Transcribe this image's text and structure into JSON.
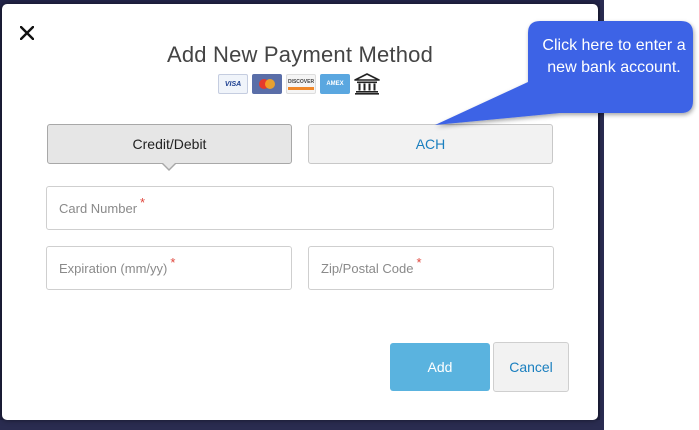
{
  "modal": {
    "title": "Add New Payment Method",
    "close_icon": "close-icon"
  },
  "card_icons": [
    {
      "name": "visa-icon",
      "label": "VISA"
    },
    {
      "name": "mastercard-icon",
      "label": ""
    },
    {
      "name": "discover-icon",
      "label": "DISCOVER"
    },
    {
      "name": "amex-icon",
      "label": "AMEX"
    },
    {
      "name": "bank-icon",
      "label": ""
    }
  ],
  "tabs": {
    "credit_label": "Credit/Debit",
    "ach_label": "ACH",
    "selected": "Credit/Debit"
  },
  "fields": {
    "card_number_placeholder": "Card Number",
    "expiration_placeholder": "Expiration (mm/yy)",
    "zip_placeholder": "Zip/Postal Code",
    "required_marker": "*"
  },
  "buttons": {
    "add_label": "Add",
    "cancel_label": "Cancel"
  },
  "callout": {
    "text": "Click here to enter a new bank account."
  },
  "colors": {
    "accent_blue": "#5ab3df",
    "link_blue": "#1a7fbf",
    "callout_blue": "#3d63e6",
    "required_red": "#e0463c"
  }
}
